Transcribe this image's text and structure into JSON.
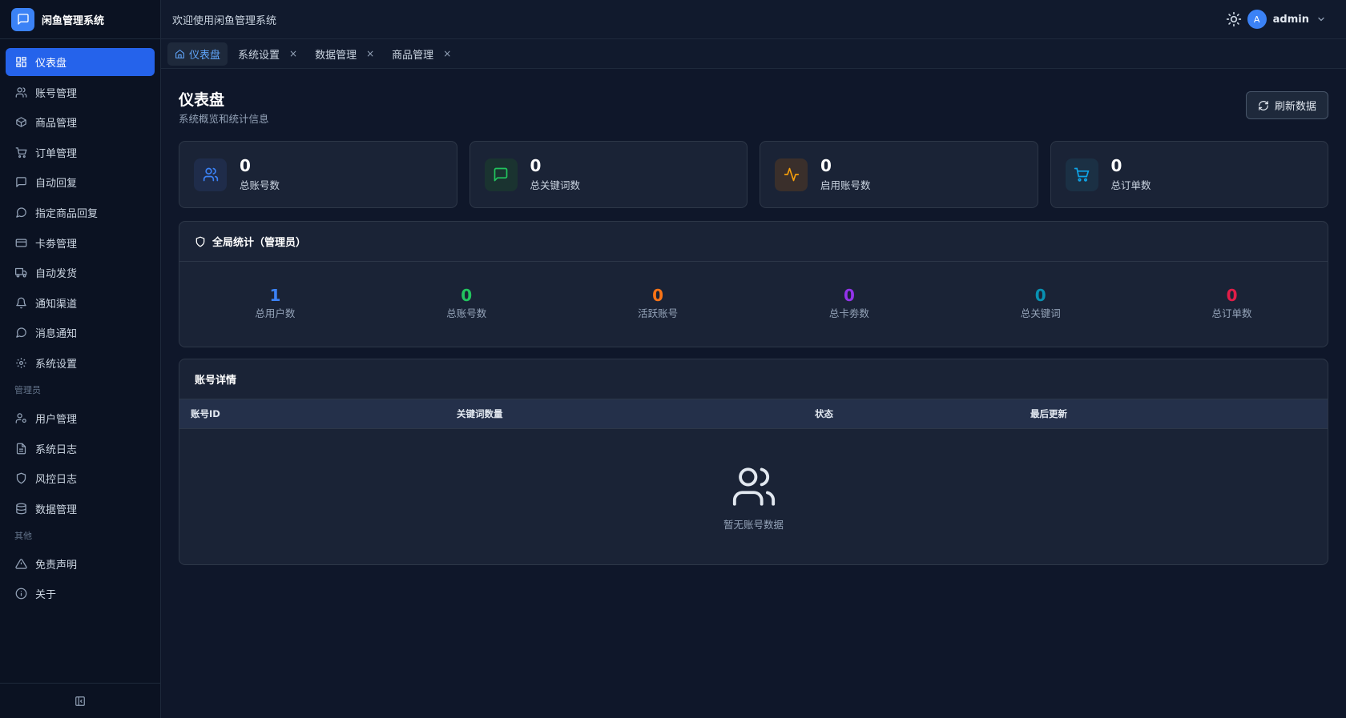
{
  "app": {
    "title": "闲鱼管理系统"
  },
  "sidebar": {
    "items": [
      {
        "label": "仪表盘",
        "icon": "dashboard-icon",
        "active": true
      },
      {
        "label": "账号管理",
        "icon": "users-icon"
      },
      {
        "label": "商品管理",
        "icon": "box-icon"
      },
      {
        "label": "订单管理",
        "icon": "cart-icon"
      },
      {
        "label": "自动回复",
        "icon": "message-square-icon"
      },
      {
        "label": "指定商品回复",
        "icon": "message-circle-icon"
      },
      {
        "label": "卡劵管理",
        "icon": "credit-card-icon"
      },
      {
        "label": "自动发货",
        "icon": "truck-icon"
      },
      {
        "label": "通知渠道",
        "icon": "bell-icon"
      },
      {
        "label": "消息通知",
        "icon": "message-circle-icon"
      },
      {
        "label": "系统设置",
        "icon": "gear-icon"
      }
    ],
    "admin_section": "管理员",
    "admin_items": [
      {
        "label": "用户管理",
        "icon": "user-cog-icon"
      },
      {
        "label": "系统日志",
        "icon": "file-text-icon"
      },
      {
        "label": "风控日志",
        "icon": "shield-icon"
      },
      {
        "label": "数据管理",
        "icon": "database-icon"
      }
    ],
    "other_section": "其他",
    "other_items": [
      {
        "label": "免责声明",
        "icon": "alert-triangle-icon"
      },
      {
        "label": "关于",
        "icon": "info-icon"
      }
    ]
  },
  "topbar": {
    "welcome": "欢迎使用闲鱼管理系统",
    "user": {
      "initial": "A",
      "name": "admin"
    }
  },
  "tabs": [
    {
      "label": "仪表盘",
      "active": true
    },
    {
      "label": "系统设置",
      "close": "×"
    },
    {
      "label": "数据管理",
      "close": "×"
    },
    {
      "label": "商品管理",
      "close": "×"
    }
  ],
  "page": {
    "title": "仪表盘",
    "subtitle": "系统概览和统计信息",
    "refresh_label": "刷新数据"
  },
  "stats": [
    {
      "value": "0",
      "label": "总账号数",
      "icon": "users-icon",
      "color": "#3b82f6",
      "bg": "#1f2c4a"
    },
    {
      "value": "0",
      "label": "总关键词数",
      "icon": "message-square-icon",
      "color": "#22c55e",
      "bg": "#1a3330"
    },
    {
      "value": "0",
      "label": "启用账号数",
      "icon": "activity-icon",
      "color": "#f59e0b",
      "bg": "#3a2f2b"
    },
    {
      "value": "0",
      "label": "总订单数",
      "icon": "cart-icon",
      "color": "#0ea5e9",
      "bg": "#1b3044"
    }
  ],
  "global": {
    "title": "全局统计（管理员）",
    "items": [
      {
        "value": "1",
        "label": "总用户数",
        "color": "#3b82f6"
      },
      {
        "value": "0",
        "label": "总账号数",
        "color": "#22c55e"
      },
      {
        "value": "0",
        "label": "活跃账号",
        "color": "#f97316"
      },
      {
        "value": "0",
        "label": "总卡劵数",
        "color": "#9333ea"
      },
      {
        "value": "0",
        "label": "总关键词",
        "color": "#0891b2"
      },
      {
        "value": "0",
        "label": "总订单数",
        "color": "#e11d48"
      }
    ]
  },
  "accounts": {
    "title": "账号详情",
    "columns": [
      "账号ID",
      "关键词数量",
      "状态",
      "最后更新"
    ],
    "empty_text": "暂无账号数据"
  }
}
